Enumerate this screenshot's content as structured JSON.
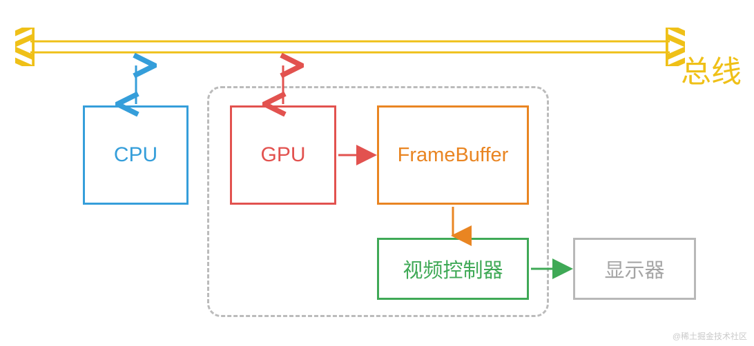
{
  "bus": {
    "label": "总线",
    "color": "#EFC018"
  },
  "nodes": {
    "cpu": {
      "label": "CPU",
      "color": "#359EDA"
    },
    "gpu": {
      "label": "GPU",
      "color": "#E2524F"
    },
    "framebuffer": {
      "label": "FrameBuffer",
      "color": "#E98522"
    },
    "video_controller": {
      "label": "视频控制器",
      "color": "#3FA956"
    },
    "display": {
      "label": "显示器",
      "color": "#A5A5A5"
    }
  },
  "edges": [
    {
      "from": "bus",
      "to": "cpu",
      "kind": "bidirectional",
      "color": "#359EDA"
    },
    {
      "from": "bus",
      "to": "gpu",
      "kind": "bidirectional",
      "color": "#E2524F"
    },
    {
      "from": "gpu",
      "to": "framebuffer",
      "kind": "unidirectional",
      "color": "#E2524F"
    },
    {
      "from": "framebuffer",
      "to": "video_controller",
      "kind": "unidirectional",
      "color": "#E98522"
    },
    {
      "from": "video_controller",
      "to": "display",
      "kind": "unidirectional",
      "color": "#3FA956"
    }
  ],
  "watermark": "@稀土掘金技术社区"
}
